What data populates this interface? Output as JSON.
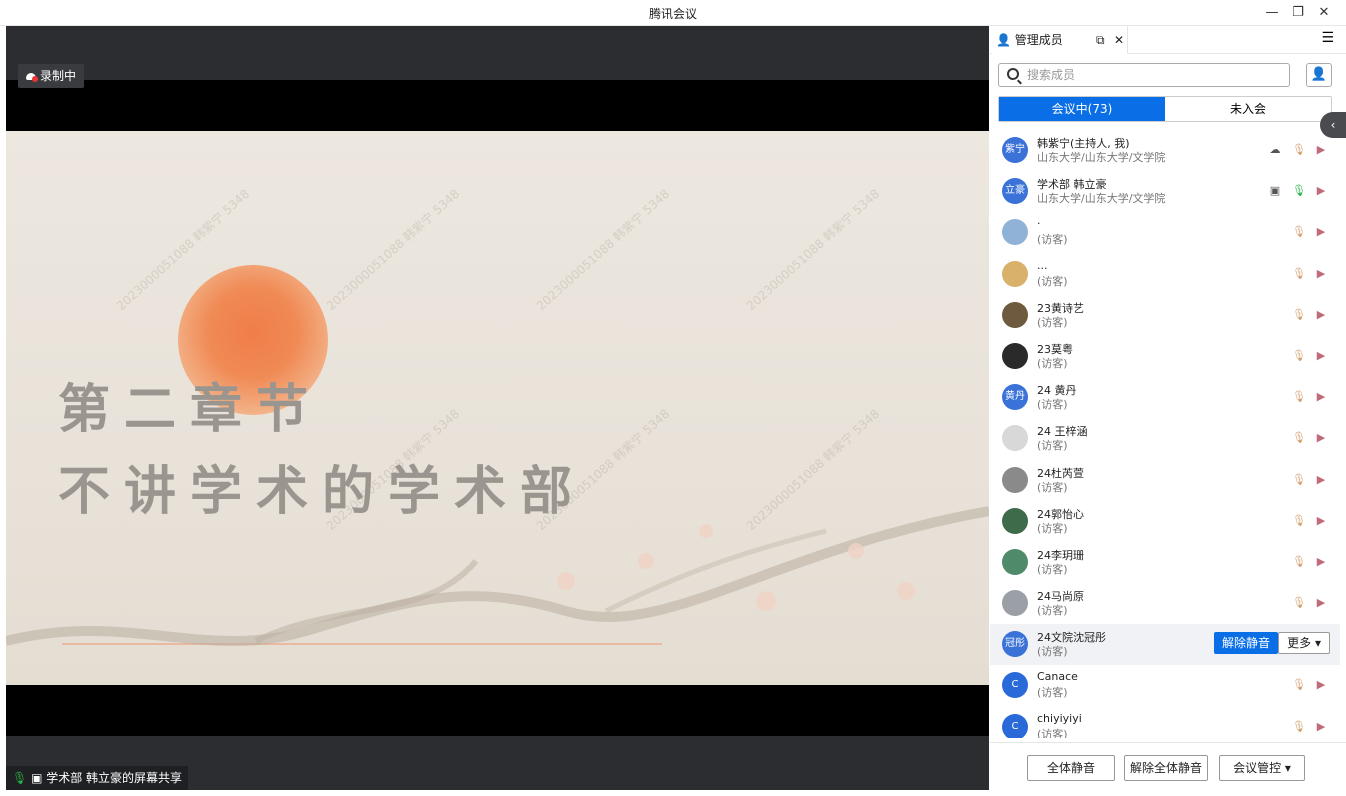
{
  "window": {
    "title": "腾讯会议"
  },
  "stage": {
    "recording_label": "录制中",
    "slide_line1": "第二章节",
    "slide_line2": "不讲学术的学术部",
    "watermark_text": "2023000051088 韩紫宁 5348",
    "share_label": "学术部 韩立豪的屏幕共享"
  },
  "panel": {
    "tab_label": "管理成员",
    "search_placeholder": "搜索成员",
    "seg_in": "会议中(73)",
    "seg_out": "未入会",
    "members": [
      {
        "avatar": "紫宁",
        "name": "韩紫宁(主持人, 我)",
        "sub": "山东大学/山东大学/文学院",
        "color": "#3a72d8",
        "rec": true
      },
      {
        "avatar": "立豪",
        "name": "学术部 韩立豪",
        "sub": "山东大学/山东大学/文学院",
        "color": "#3a72d8",
        "sharing": true,
        "mic_on": true
      },
      {
        "avatar": "",
        "name": "·",
        "sub": "(访客)",
        "color": "#8fb2d6"
      },
      {
        "avatar": "",
        "name": "...",
        "sub": "(访客)",
        "color": "#d9b16a"
      },
      {
        "avatar": "",
        "name": "23黄诗艺",
        "sub": "(访客)",
        "color": "#6e5a3e"
      },
      {
        "avatar": "",
        "name": "23莫粤",
        "sub": "(访客)",
        "color": "#2a2a2a"
      },
      {
        "avatar": "黄丹",
        "name": "24 黄丹",
        "sub": "(访客)",
        "color": "#3a72d8"
      },
      {
        "avatar": "",
        "name": "24 王梓涵",
        "sub": "(访客)",
        "color": "#d8d8d8"
      },
      {
        "avatar": "",
        "name": "24杜芮萱",
        "sub": "(访客)",
        "color": "#8a8a8a"
      },
      {
        "avatar": "",
        "name": "24郭怡心",
        "sub": "(访客)",
        "color": "#3e6b4a"
      },
      {
        "avatar": "",
        "name": "24李玥珊",
        "sub": "(访客)",
        "color": "#4f8a6a"
      },
      {
        "avatar": "",
        "name": "24马尚原",
        "sub": "(访客)",
        "color": "#9aa0a6"
      },
      {
        "avatar": "冠彤",
        "name": "24文院沈冠彤",
        "sub": "(访客)",
        "color": "#3a72d8",
        "highlight": true
      },
      {
        "avatar": "C",
        "name": "Canace",
        "sub": "(访客)",
        "color": "#2a6ad8"
      },
      {
        "avatar": "C",
        "name": "chiyiyiyi",
        "sub": "(访客)",
        "color": "#2a6ad8"
      }
    ],
    "unmute_label": "解除静音",
    "more_label": "更多 ▾",
    "footer": {
      "mute_all": "全体静音",
      "unmute_all": "解除全体静音",
      "control": "会议管控 ▾"
    }
  }
}
